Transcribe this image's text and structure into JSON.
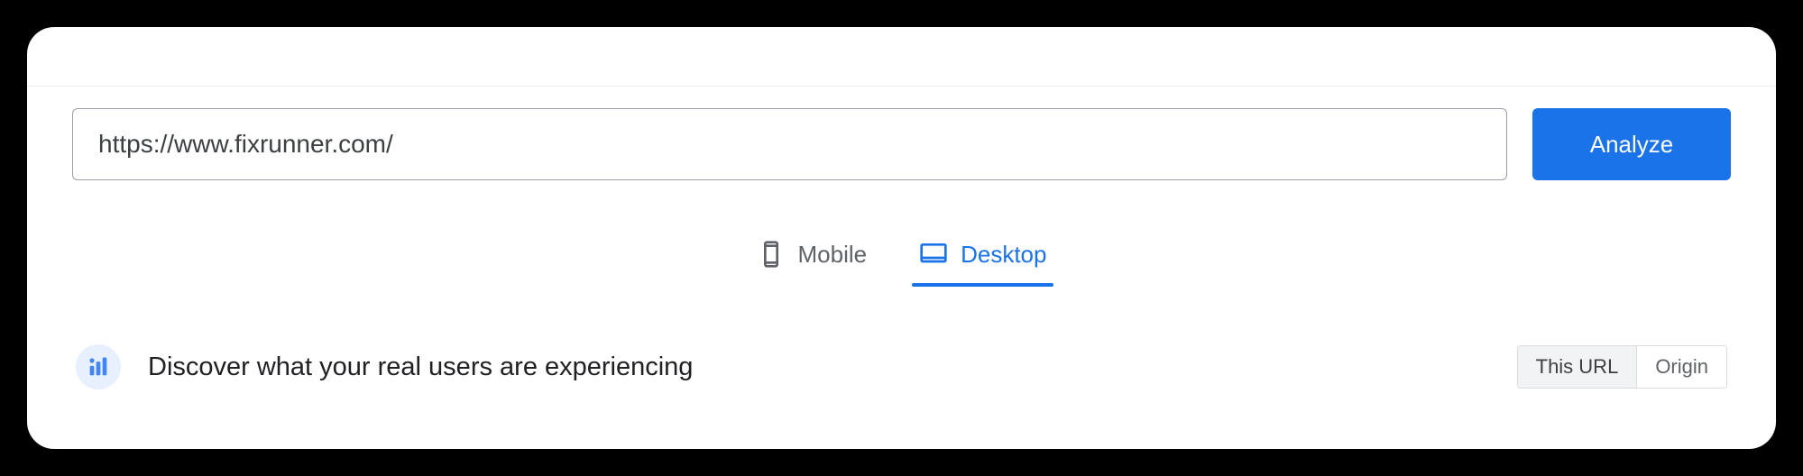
{
  "url_input": {
    "value": "https://www.fixrunner.com/"
  },
  "analyze_button": {
    "label": "Analyze"
  },
  "tabs": {
    "mobile": {
      "label": "Mobile"
    },
    "desktop": {
      "label": "Desktop"
    }
  },
  "discover": {
    "heading": "Discover what your real users are experiencing"
  },
  "scope": {
    "this_url": "This URL",
    "origin": "Origin"
  }
}
